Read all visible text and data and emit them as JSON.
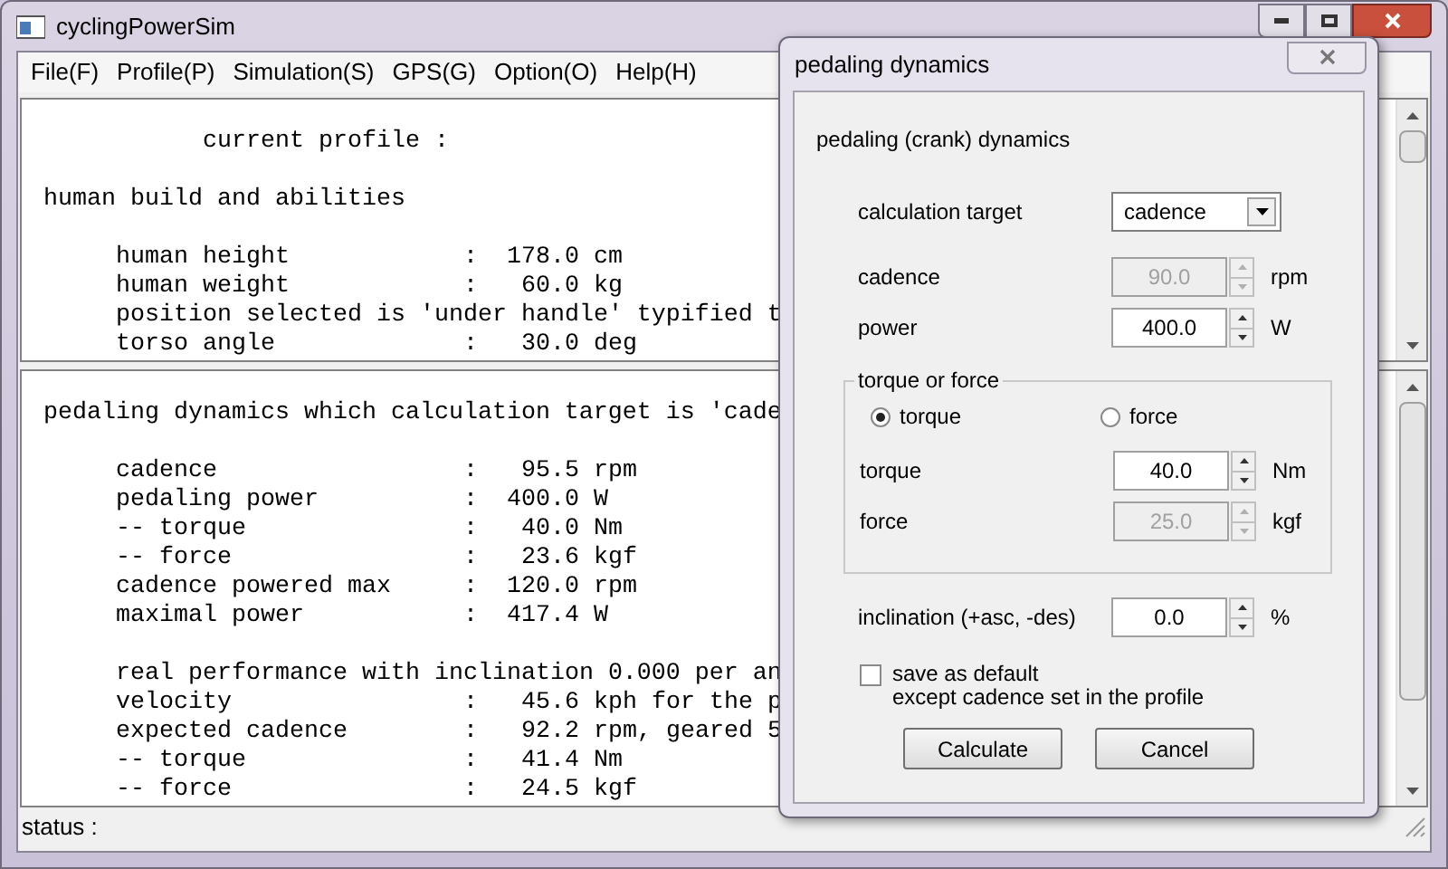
{
  "window": {
    "title": "cyclingPowerSim"
  },
  "menu": [
    "File(F)",
    "Profile(P)",
    "Simulation(S)",
    "GPS(G)",
    "Option(O)",
    "Help(H)"
  ],
  "profile_pane": {
    "lines": [
      {
        "kind": "blank"
      },
      {
        "kind": "title",
        "text": "current profile :"
      },
      {
        "kind": "blank"
      },
      {
        "kind": "heading",
        "text": "human build and abilities"
      },
      {
        "kind": "blank"
      },
      {
        "kind": "item",
        "label": "human height",
        "value": ":  178.0 cm"
      },
      {
        "kind": "item",
        "label": "human weight",
        "value": ":   60.0 kg"
      },
      {
        "kind": "text",
        "text": "position selected is 'under handle' typified t"
      },
      {
        "kind": "item",
        "label": "torso angle",
        "value": ":   30.0 deg"
      }
    ]
  },
  "result_pane": {
    "lines": [
      {
        "kind": "blank"
      },
      {
        "kind": "heading",
        "text": "pedaling dynamics which calculation target is 'cade"
      },
      {
        "kind": "blank"
      },
      {
        "kind": "item",
        "label": "cadence",
        "value": ":   95.5 rpm"
      },
      {
        "kind": "item",
        "label": "pedaling power",
        "value": ":  400.0 W"
      },
      {
        "kind": "item",
        "label": "-- torque",
        "value": ":   40.0 Nm"
      },
      {
        "kind": "item",
        "label": "-- force",
        "value": ":   23.6 kgf"
      },
      {
        "kind": "item",
        "label": "cadence powered max",
        "value": ":  120.0 rpm"
      },
      {
        "kind": "item",
        "label": "maximal power",
        "value": ":  417.4 W"
      },
      {
        "kind": "blank"
      },
      {
        "kind": "text",
        "text": "real performance with inclination 0.000 per an"
      },
      {
        "kind": "item",
        "label": "velocity",
        "value": ":   45.6 kph for the p"
      },
      {
        "kind": "item",
        "label": "expected cadence",
        "value": ":   92.2 rpm, geared 5"
      },
      {
        "kind": "item",
        "label": "-- torque",
        "value": ":   41.4 Nm"
      },
      {
        "kind": "item",
        "label": "-- force",
        "value": ":   24.5 kgf"
      }
    ]
  },
  "status_bar": {
    "text": "status :"
  },
  "dialog": {
    "title": "pedaling dynamics",
    "heading": "pedaling (crank) dynamics",
    "target": {
      "label": "calculation target",
      "value": "cadence"
    },
    "fields_top": [
      {
        "label": "cadence",
        "value": "90.0",
        "unit": "rpm",
        "disabled": true
      },
      {
        "label": "power",
        "value": "400.0",
        "unit": "W",
        "disabled": false
      }
    ],
    "group": {
      "title": "torque or force",
      "radios": [
        {
          "label": "torque",
          "selected": true
        },
        {
          "label": "force",
          "selected": false
        }
      ],
      "fields": [
        {
          "label": "torque",
          "value": "40.0",
          "unit": "Nm",
          "disabled": false
        },
        {
          "label": "force",
          "value": "25.0",
          "unit": "kgf",
          "disabled": true
        }
      ]
    },
    "inclination": {
      "label": "inclination (+asc, -des)",
      "value": "0.0",
      "unit": "%",
      "disabled": false
    },
    "save_default": {
      "lines": [
        "save as default",
        "except cadence set in the profile"
      ],
      "checked": false
    },
    "buttons": [
      "Calculate",
      "Cancel"
    ]
  }
}
